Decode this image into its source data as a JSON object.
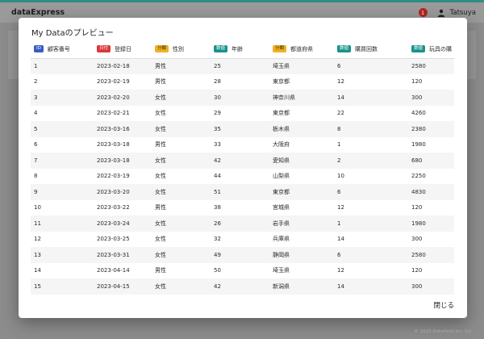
{
  "appbar": {
    "brand": "dataExpress",
    "notification_count": "1",
    "user_name": "Tatsuya",
    "accent_color": "#2f8d83"
  },
  "modal": {
    "title": "My Dataのプレビュー",
    "close_label": "閉じる"
  },
  "table": {
    "columns": [
      {
        "badge": "ID",
        "type": "id",
        "label": "顧客番号"
      },
      {
        "badge": "日付",
        "type": "date",
        "label": "登録日"
      },
      {
        "badge": "分類",
        "type": "cat",
        "label": "性別"
      },
      {
        "badge": "数値",
        "type": "num",
        "label": "年齢"
      },
      {
        "badge": "分類",
        "type": "cat",
        "label": "都道府県"
      },
      {
        "badge": "数値",
        "type": "num",
        "label": "購買回数"
      },
      {
        "badge": "数値",
        "type": "num",
        "label": "玩具の購"
      }
    ],
    "rows": [
      [
        "1",
        "2023-02-18",
        "男性",
        "25",
        "埼玉県",
        "6",
        "2580"
      ],
      [
        "2",
        "2023-02-19",
        "男性",
        "28",
        "東京都",
        "12",
        "120"
      ],
      [
        "3",
        "2023-02-20",
        "女性",
        "30",
        "神奈川県",
        "14",
        "300"
      ],
      [
        "4",
        "2023-02-21",
        "女性",
        "29",
        "東京都",
        "22",
        "4260"
      ],
      [
        "5",
        "2023-03-16",
        "女性",
        "35",
        "栃木県",
        "8",
        "2380"
      ],
      [
        "6",
        "2023-03-18",
        "男性",
        "33",
        "大阪府",
        "1",
        "1980"
      ],
      [
        "7",
        "2023-03-18",
        "女性",
        "42",
        "愛知県",
        "2",
        "680"
      ],
      [
        "8",
        "2022-03-19",
        "女性",
        "44",
        "山梨県",
        "10",
        "2250"
      ],
      [
        "9",
        "2023-03-20",
        "女性",
        "51",
        "東京都",
        "6",
        "4830"
      ],
      [
        "10",
        "2023-03-22",
        "男性",
        "38",
        "宮城県",
        "12",
        "120"
      ],
      [
        "11",
        "2023-03-24",
        "女性",
        "26",
        "岩手県",
        "1",
        "1980"
      ],
      [
        "12",
        "2023-03-25",
        "女性",
        "32",
        "兵庫県",
        "14",
        "300"
      ],
      [
        "13",
        "2023-03-31",
        "女性",
        "49",
        "静岡県",
        "6",
        "2580"
      ],
      [
        "14",
        "2023-04-14",
        "男性",
        "50",
        "埼玉県",
        "12",
        "120"
      ],
      [
        "15",
        "2023-04-15",
        "女性",
        "42",
        "新潟県",
        "14",
        "300"
      ]
    ]
  },
  "footer": {
    "copyright": "© 2023 DataHerb Inc. Inc."
  }
}
